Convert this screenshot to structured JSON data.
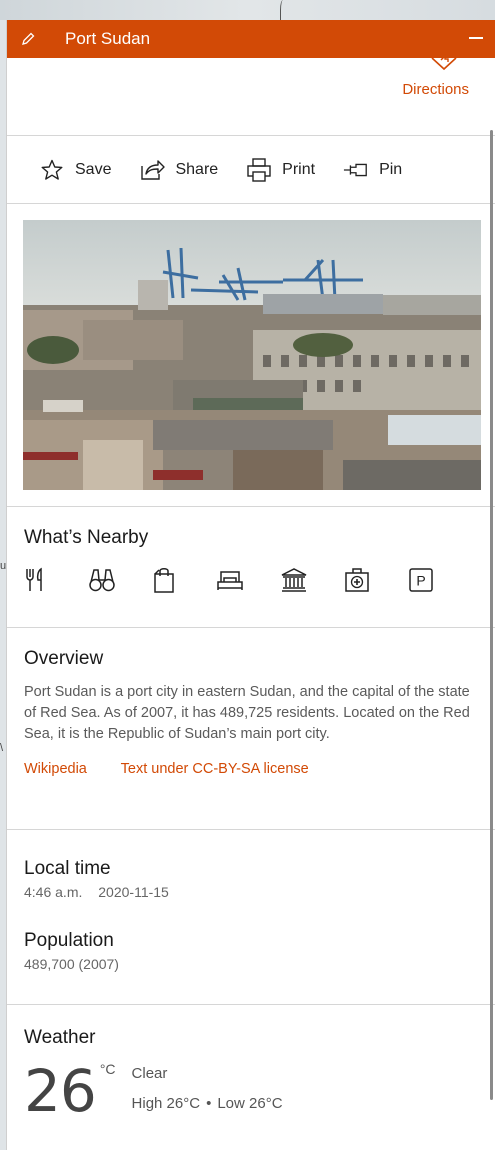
{
  "window": {
    "title": "Port Sudan"
  },
  "directions": {
    "label": "Directions"
  },
  "actions": [
    {
      "label": "Save",
      "icon": "star-icon"
    },
    {
      "label": "Share",
      "icon": "share-icon"
    },
    {
      "label": "Print",
      "icon": "printer-icon"
    },
    {
      "label": "Pin",
      "icon": "pin-icon"
    }
  ],
  "nearby": {
    "title": "What’s Nearby",
    "icons": [
      "restaurant-icon",
      "binoculars-icon",
      "shopping-bag-icon",
      "hotel-icon",
      "museum-icon",
      "hospital-icon",
      "parking-icon"
    ],
    "parking_letter": "P"
  },
  "overview": {
    "title": "Overview",
    "text": "Port Sudan is a port city in eastern Sudan, and the capital of the state of Red Sea. As of 2007, it has 489,725 residents. Located on the Red Sea, it is the Republic of Sudan’s main port city.",
    "link_wikipedia": "Wikipedia",
    "link_license": "Text under CC-BY-SA license"
  },
  "local_time": {
    "title": "Local time",
    "time": "4:46 a.m.",
    "date": "2020-11-15"
  },
  "population": {
    "title": "Population",
    "value": "489,700 (2007)"
  },
  "weather": {
    "title": "Weather",
    "temp": "26",
    "unit": "°C",
    "condition": "Clear",
    "high": "High 26°C",
    "separator": "•",
    "low": "Low 26°C"
  },
  "map_fragments": {
    "left_top": "u",
    "left_bottom": "\\"
  },
  "colors": {
    "accent": "#d24a06"
  }
}
